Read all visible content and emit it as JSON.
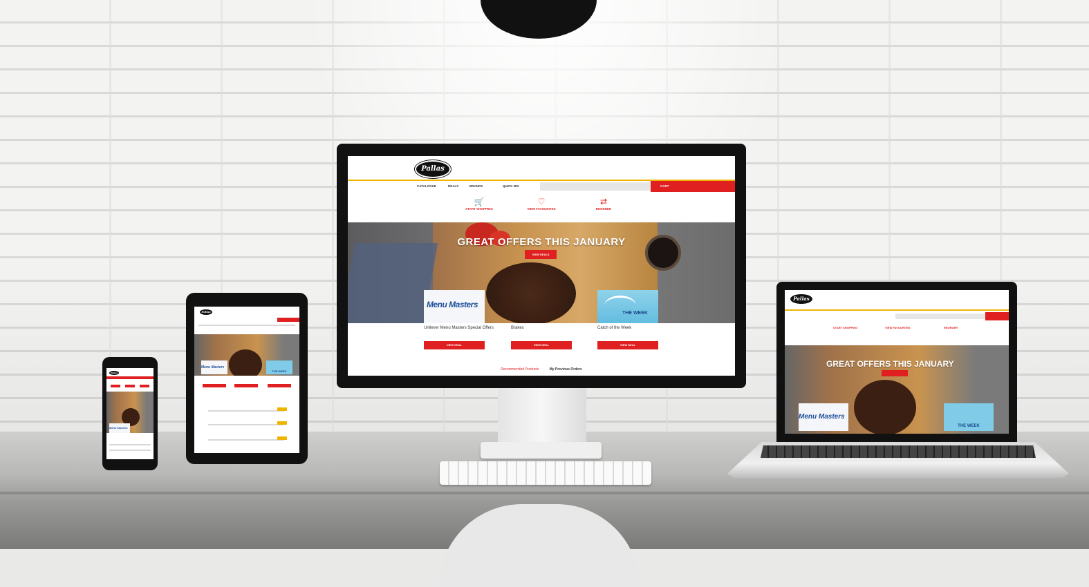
{
  "site": {
    "logo_text": "Pallas",
    "top_links": [
      "",
      "",
      "",
      "",
      ""
    ],
    "nav": [
      "CATALOGUE",
      "DEALS",
      "BRANDS",
      "QUICK MIX"
    ],
    "search_placeholder": "",
    "cart_label": "CART",
    "quick_links": [
      {
        "icon": "cart-icon",
        "glyph": "🛒",
        "label": "START SHOPPING"
      },
      {
        "icon": "heart-icon",
        "glyph": "♡",
        "label": "VIEW FAVOURITES"
      },
      {
        "icon": "reorder-icon",
        "glyph": "⇄",
        "label": "REORDER"
      }
    ],
    "hero": {
      "subtitle": "",
      "title": "GREAT OFFERS THIS JANUARY",
      "button": "VIEW DEALS"
    },
    "cards": [
      {
        "image_text": "Menu Masters",
        "name": "Unilever Menu Masters Special Offers",
        "desc": "",
        "button": "VIEW DEAL"
      },
      {
        "image_text": "",
        "name": "Brakes",
        "desc": "",
        "button": "VIEW DEAL"
      },
      {
        "image_text": "THE WEEK",
        "name": "Catch of the Week",
        "desc": "",
        "button": "VIEW DEAL"
      }
    ],
    "bottom_tabs": [
      "Recommended Products",
      "My Previous Orders"
    ]
  },
  "colors": {
    "accent": "#e02020",
    "highlight": "#f0b400",
    "lamp": "#111111",
    "wall": "#f3f3f2"
  }
}
